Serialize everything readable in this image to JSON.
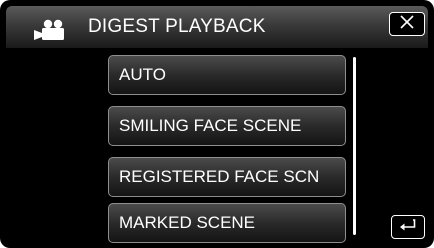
{
  "header": {
    "title": "DIGEST PLAYBACK",
    "mode_icon": "video-camera-icon",
    "close_icon": "close-icon"
  },
  "menu": {
    "items": [
      {
        "label": "AUTO"
      },
      {
        "label": "SMILING FACE SCENE"
      },
      {
        "label": "REGISTERED FACE SCN"
      },
      {
        "label": "MARKED SCENE"
      }
    ]
  },
  "footer": {
    "back_icon": "return-icon"
  },
  "colors": {
    "background": "#000000",
    "text": "#ffffff",
    "button_border": "#8e8e8e"
  }
}
